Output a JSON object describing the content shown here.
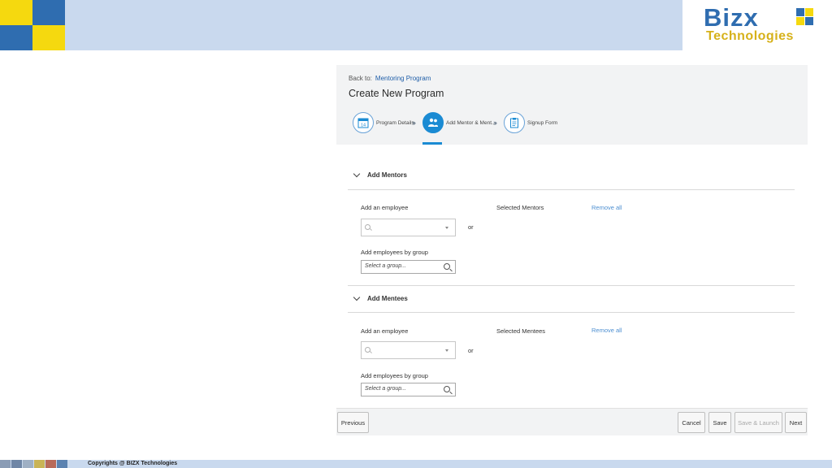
{
  "brand": {
    "name": "Bizx",
    "subtitle": "Technologies",
    "colors": {
      "blue": "#2f6db0",
      "yellow": "#f5d90f",
      "band": "#c9d9ee",
      "accent": "#1b8bd3"
    }
  },
  "header": {
    "back_prefix": "Back to:",
    "back_link": "Mentoring Program",
    "title": "Create New Program"
  },
  "steps": [
    {
      "label": "Program Details",
      "icon": "calendar-icon",
      "icon_text": "14",
      "active": false
    },
    {
      "label": "Add Mentor & Ment...",
      "icon": "people-icon",
      "active": true
    },
    {
      "label": "Signup Form",
      "icon": "clipboard-icon",
      "active": false
    }
  ],
  "mentors": {
    "title": "Add Mentors",
    "add_employee_label": "Add an employee",
    "or_label": "or",
    "group_label": "Add employees by group",
    "group_placeholder": "Select a group...",
    "selected_label": "Selected Mentors",
    "remove_all": "Remove all"
  },
  "mentees": {
    "title": "Add Mentees",
    "add_employee_label": "Add an employee",
    "or_label": "or",
    "group_label": "Add employees by group",
    "group_placeholder": "Select a group...",
    "selected_label": "Selected Mentees",
    "remove_all": "Remove all"
  },
  "footer": {
    "previous": "Previous",
    "cancel": "Cancel",
    "save": "Save",
    "save_launch": "Save & Launch",
    "next": "Next"
  },
  "slide_footer": {
    "copyright": "Copyrights @ BIZX Technologies"
  }
}
